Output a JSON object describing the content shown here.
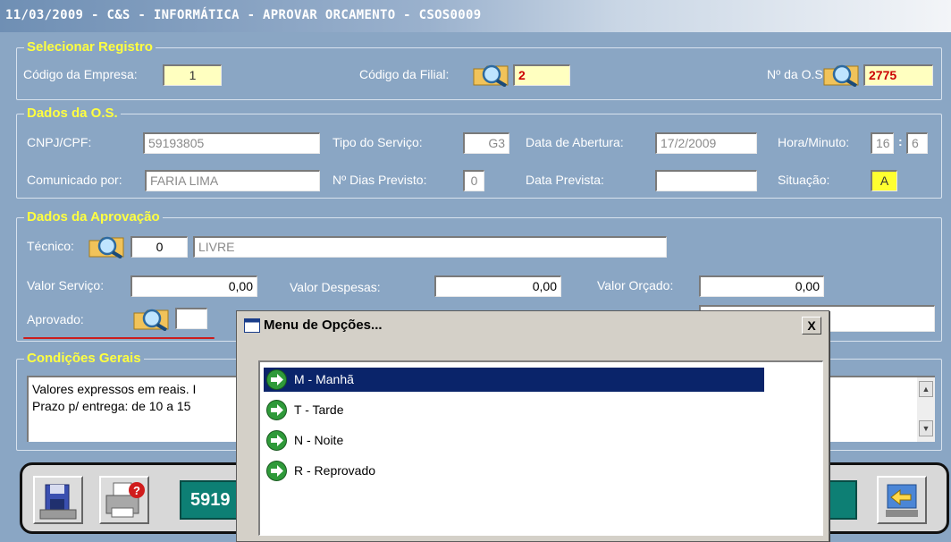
{
  "window": {
    "title": "11/03/2009 - C&S - INFORMÁTICA - APROVAR ORCAMENTO - CSOS0009"
  },
  "selecionar_registro": {
    "legend": "Selecionar Registro",
    "empresa_label": "Código da Empresa:",
    "empresa_value": "1",
    "filial_label": "Código da Filial:",
    "filial_value": "2",
    "os_label": "Nº da O.S.:",
    "os_value": "2775"
  },
  "dados_os": {
    "legend": "Dados da O.S.",
    "cnpj_label": "CNPJ/CPF:",
    "cnpj_value": "59193805",
    "tipo_label": "Tipo do Serviço:",
    "tipo_value": "G3",
    "abertura_label": "Data de Abertura:",
    "abertura_value": "17/2/2009",
    "hora_label": "Hora/Minuto:",
    "hora_value": "16",
    "hora_sep": ":",
    "minuto_value": "6",
    "comunicado_label": "Comunicado por:",
    "comunicado_value": "FARIA LIMA",
    "dias_label": "Nº Dias Previsto:",
    "dias_value": "0",
    "prevista_label": "Data Prevista:",
    "prevista_value": "",
    "situacao_label": "Situação:",
    "situacao_value": "A"
  },
  "dados_aprovacao": {
    "legend": "Dados da Aprovação",
    "tecnico_label": "Técnico:",
    "tecnico_code": "0",
    "tecnico_name": "LIVRE",
    "valor_servico_label": "Valor Serviço:",
    "valor_servico_value": "0,00",
    "valor_despesas_label": "Valor Despesas:",
    "valor_despesas_value": "0,00",
    "valor_orcado_label": "Valor Orçado:",
    "valor_orcado_value": "0,00",
    "aprovado_label": "Aprovado:",
    "aprovado_value": ""
  },
  "condicoes_gerais": {
    "legend": "Condições Gerais",
    "line1": "Valores expressos em reais. I",
    "line2": "Prazo p/ entrega: de 10 a 15"
  },
  "toolbar": {
    "code_text": "5919"
  },
  "dialog": {
    "title": "Menu de Opções...",
    "close": "X",
    "options": [
      {
        "label": "M - Manhã",
        "selected": true
      },
      {
        "label": "T - Tarde",
        "selected": false
      },
      {
        "label": "N - Noite",
        "selected": false
      },
      {
        "label": "R - Reprovado",
        "selected": false
      }
    ]
  },
  "colors": {
    "background": "#8aa6c4",
    "legend": "#ffff40",
    "selection": "#0a246a",
    "teal": "#0d7f74"
  },
  "icons": [
    "search-folder-icon",
    "save-disk-icon",
    "print-help-icon",
    "exit-icon",
    "window-icon",
    "green-arrow-icon"
  ]
}
